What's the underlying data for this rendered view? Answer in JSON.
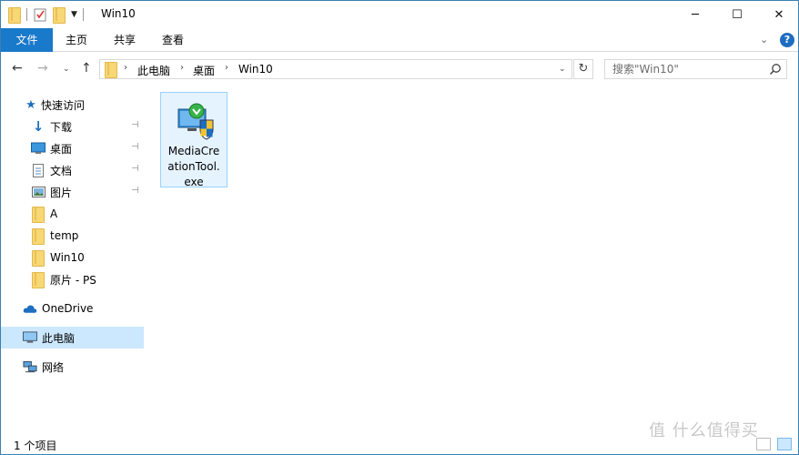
{
  "window": {
    "title": "Win10",
    "min_glyph": "─",
    "max_glyph": "☐",
    "close_glyph": "✕"
  },
  "ribbon": {
    "tabs": [
      {
        "label": "文件",
        "active": true
      },
      {
        "label": "主页"
      },
      {
        "label": "共享"
      },
      {
        "label": "查看"
      }
    ],
    "expand_glyph": "⌄",
    "help_glyph": "?"
  },
  "address": {
    "crumbs": [
      "此电脑",
      "桌面",
      "Win10"
    ],
    "separator_glyph": "›",
    "search_placeholder": "搜索\"Win10\""
  },
  "nav_glyphs": {
    "back": "←",
    "forward": "→",
    "recent": "⌄",
    "up": "↑",
    "refresh": "↻",
    "pin": "📌"
  },
  "navpane": {
    "quick_access": "快速访问",
    "quick_items": [
      {
        "label": "下载",
        "pinned": true
      },
      {
        "label": "桌面",
        "pinned": true
      },
      {
        "label": "文档",
        "pinned": true
      },
      {
        "label": "图片",
        "pinned": true
      },
      {
        "label": "A"
      },
      {
        "label": "temp"
      },
      {
        "label": "Win10"
      },
      {
        "label": "原片 - PS"
      }
    ],
    "onedrive": "OneDrive",
    "this_pc": "此电脑",
    "network": "网络"
  },
  "files": [
    {
      "name": "MediaCreationTool.exe",
      "lines": [
        "MediaCre",
        "ationTool.",
        "exe"
      ]
    }
  ],
  "status": {
    "item_count": "1 个项目"
  },
  "watermark": "值 什么值得买",
  "colors": {
    "accent": "#1979ca",
    "selection": "#cce8ff",
    "folder": "#f8d775"
  }
}
